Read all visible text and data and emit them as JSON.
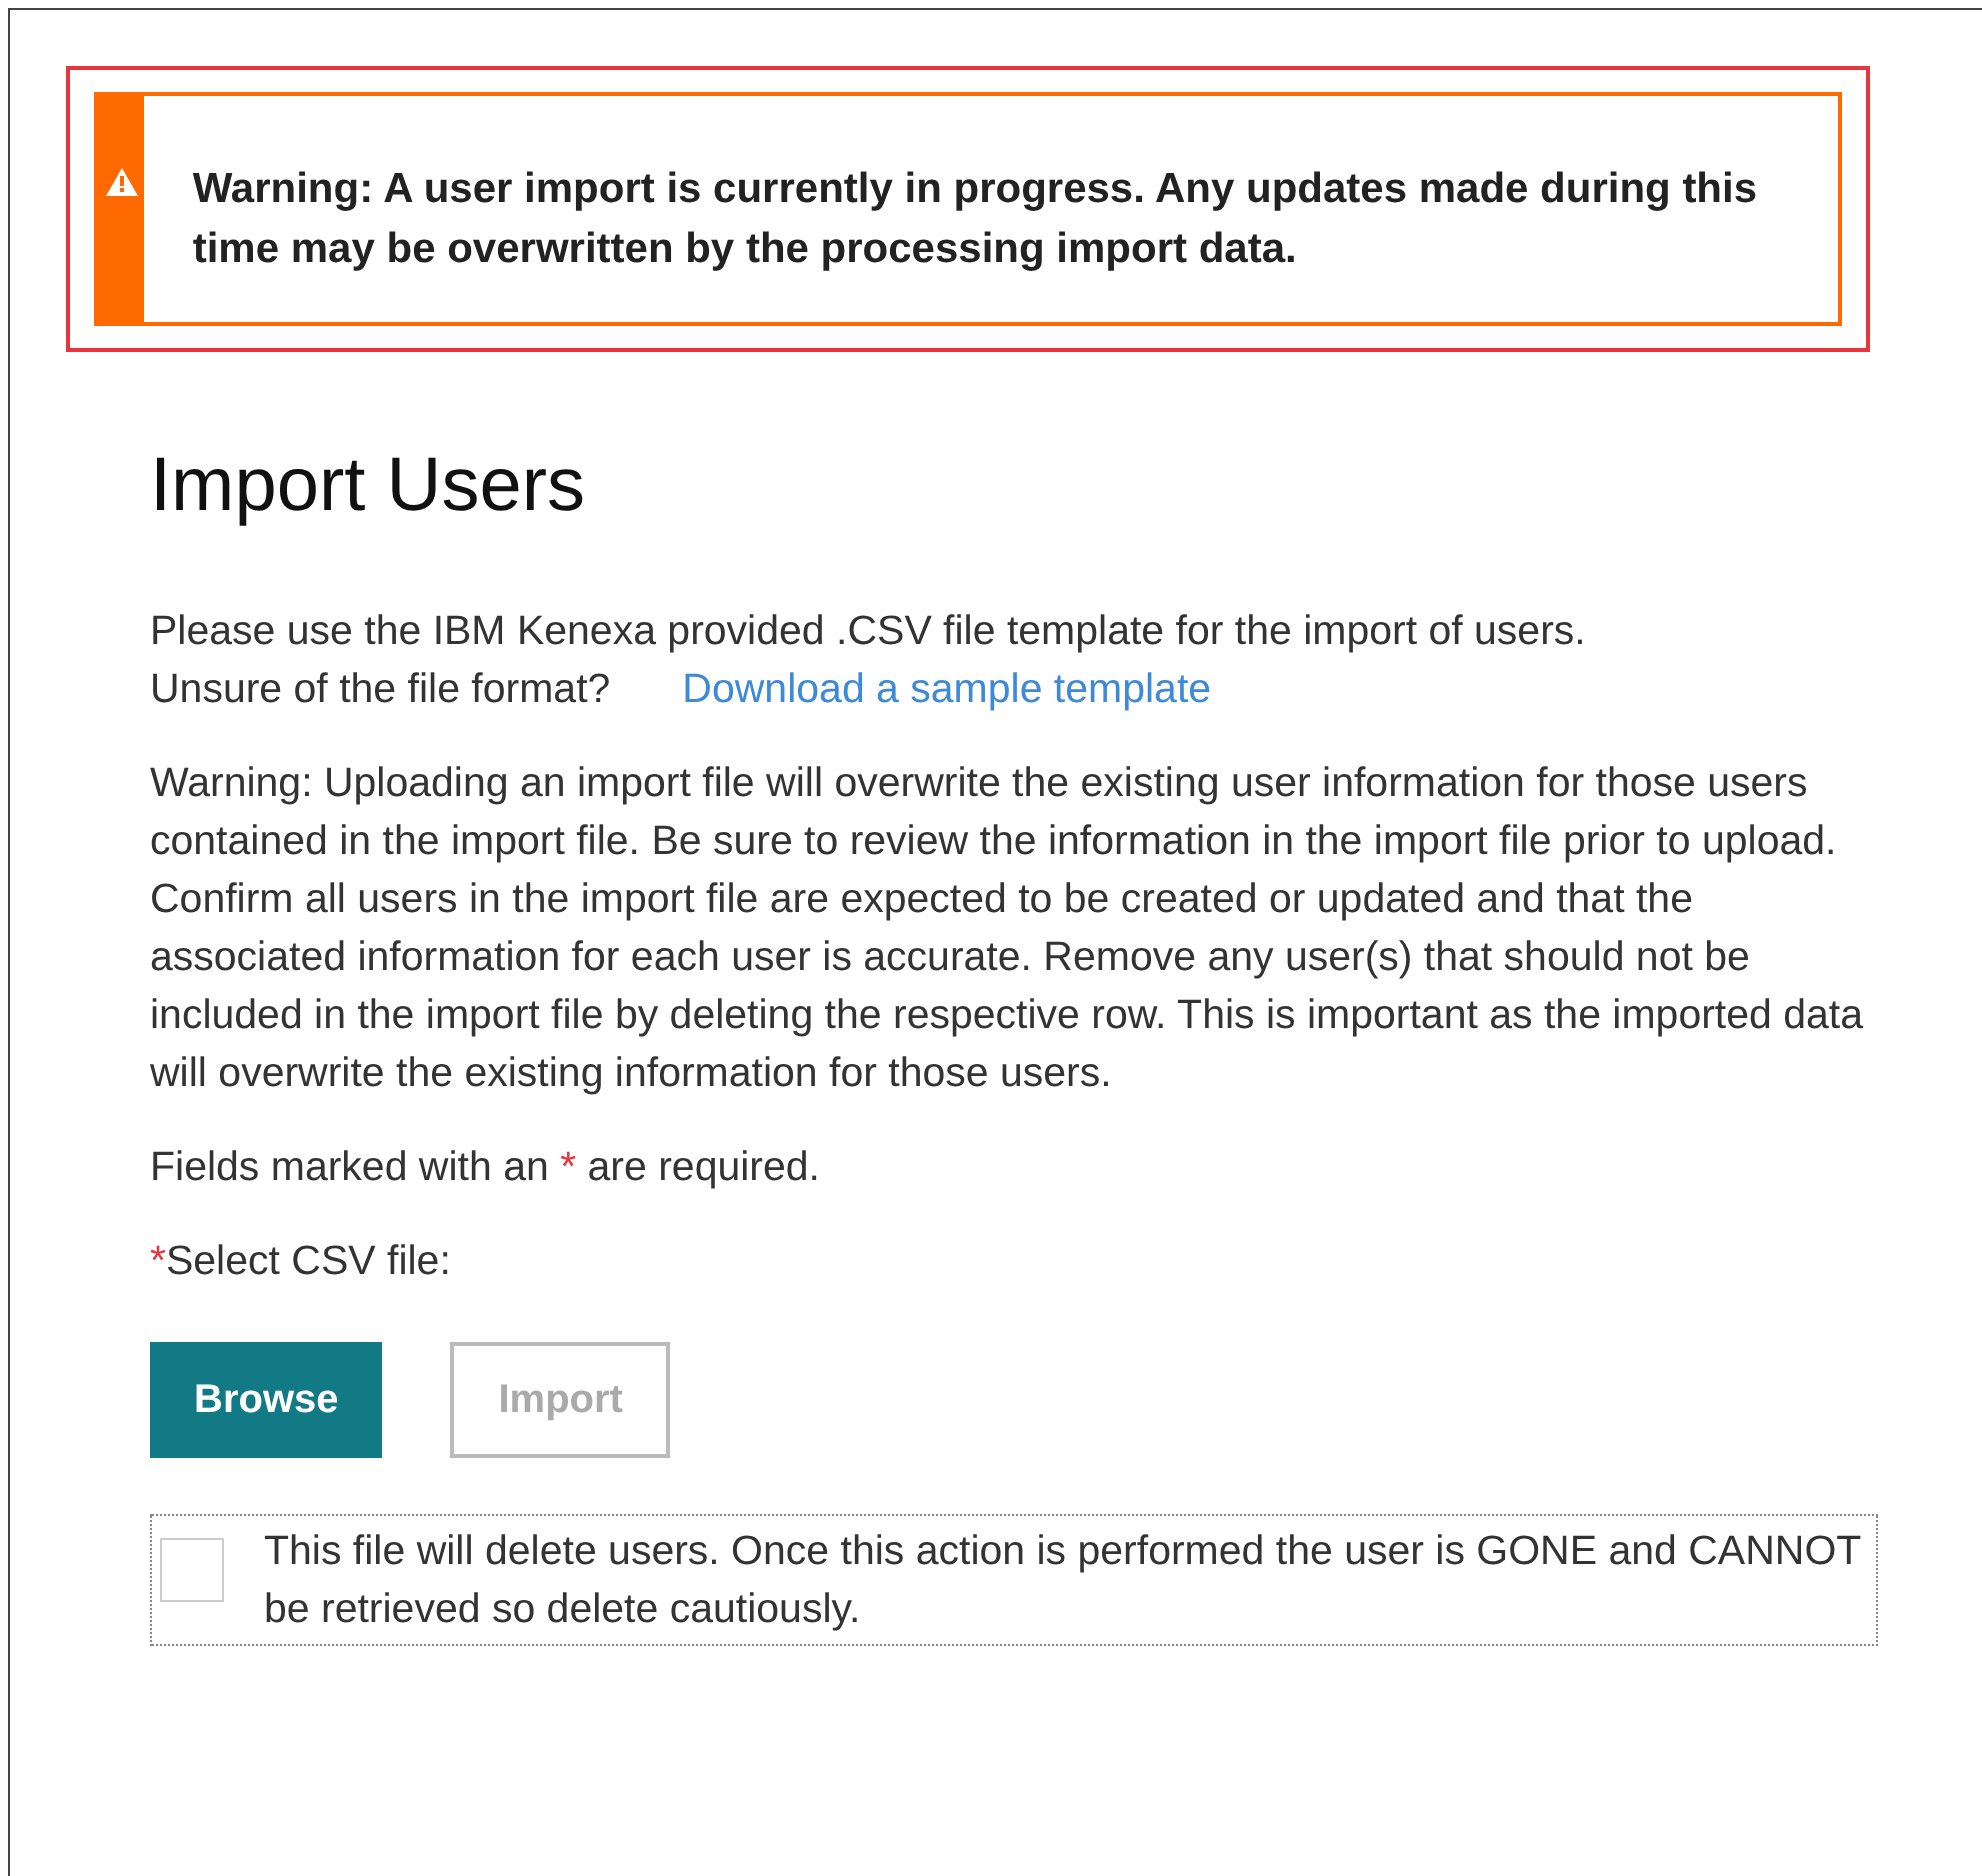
{
  "alert": {
    "text": "Warning: A user import is currently in progress. Any updates made during this time may be overwritten by the processing import data."
  },
  "title": "Import Users",
  "intro": {
    "text": "Please use the IBM Kenexa provided .CSV file template for the import of users.",
    "question": "Unsure of the file format?",
    "link": "Download a sample template"
  },
  "warning_text": "Warning: Uploading an import file will overwrite the existing user information for those users contained in the import file. Be sure to review the information in the import file prior to upload. Confirm all users in the import file are expected to be created or updated and that the associated information for each user is accurate. Remove any user(s) that should not be included in the import file by deleting the respective row. This is important as the imported data will overwrite the existing information for those users.",
  "required_note": {
    "before": "Fields marked with an ",
    "marker": "*",
    "after": " are required."
  },
  "file_field": {
    "marker": "*",
    "label": "Select CSV file:"
  },
  "buttons": [
    {
      "label": "Browse",
      "kind": "primary",
      "disabled": false
    },
    {
      "label": "Import",
      "kind": "secondary",
      "disabled": true
    }
  ],
  "delete_option": {
    "checked": false,
    "label": "This file will delete users. Once this action is performed the user is GONE and CANNOT be retrieved so delete cautiously."
  }
}
